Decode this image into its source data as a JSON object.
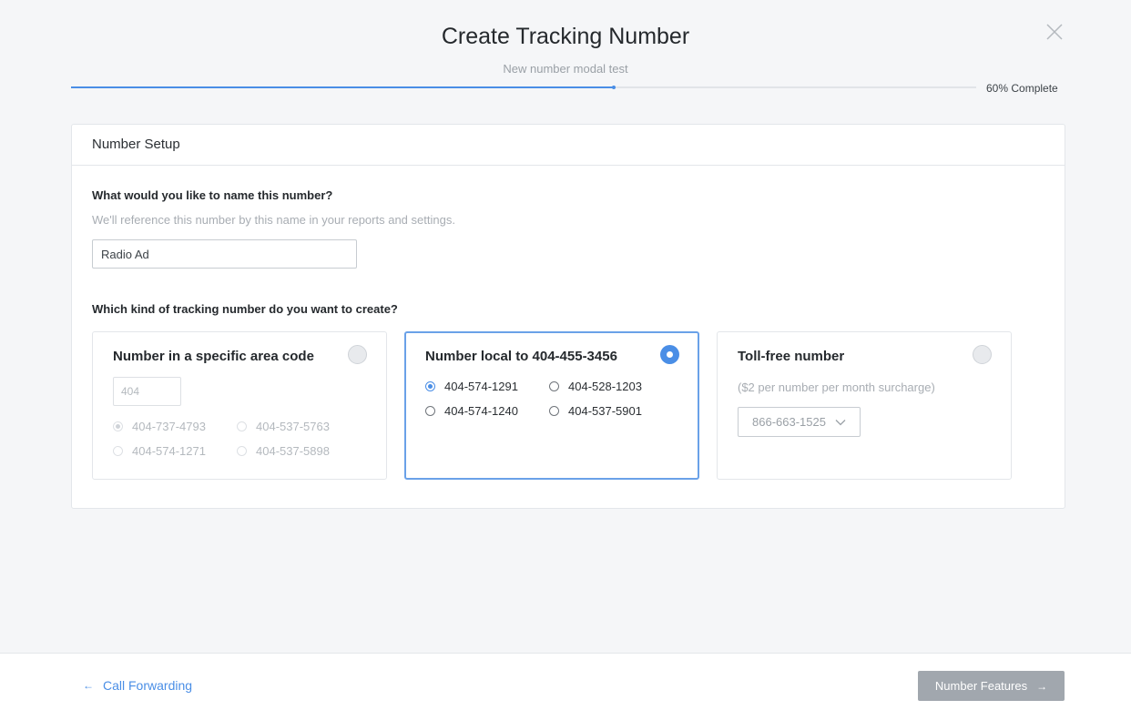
{
  "modal": {
    "title": "Create Tracking Number",
    "subtitle": "New number modal test",
    "progress": {
      "percent": 60,
      "label": "60% Complete"
    }
  },
  "setup": {
    "section_title": "Number Setup",
    "name_question": "What would you like to name this number?",
    "name_help": "We'll reference this number by this name in your reports and settings.",
    "name_value": "Radio Ad",
    "kind_question": "Which kind of tracking number do you want to create?"
  },
  "options": {
    "area_code": {
      "title": "Number in a specific area code",
      "area_value": "404",
      "numbers": [
        "404-737-4793",
        "404-537-5763",
        "404-574-1271",
        "404-537-5898"
      ],
      "selected_index": 0,
      "state": "disabled"
    },
    "local": {
      "title": "Number local to 404-455-3456",
      "numbers": [
        "404-574-1291",
        "404-528-1203",
        "404-574-1240",
        "404-537-5901"
      ],
      "selected_index": 0,
      "state": "selected"
    },
    "toll_free": {
      "title": "Toll-free number",
      "surcharge": "($2 per number per month surcharge)",
      "selected_number": "866-663-1525"
    }
  },
  "footer": {
    "back_label": "Call Forwarding",
    "next_label": "Number Features"
  },
  "colors": {
    "accent": "#4a8ee6",
    "next_button": "#a1a7ae",
    "background": "#f5f6f8"
  },
  "icons": {
    "close": "close-icon",
    "back": "arrow-left-icon",
    "next": "arrow-right-icon",
    "dropdown": "chevron-down-icon"
  }
}
